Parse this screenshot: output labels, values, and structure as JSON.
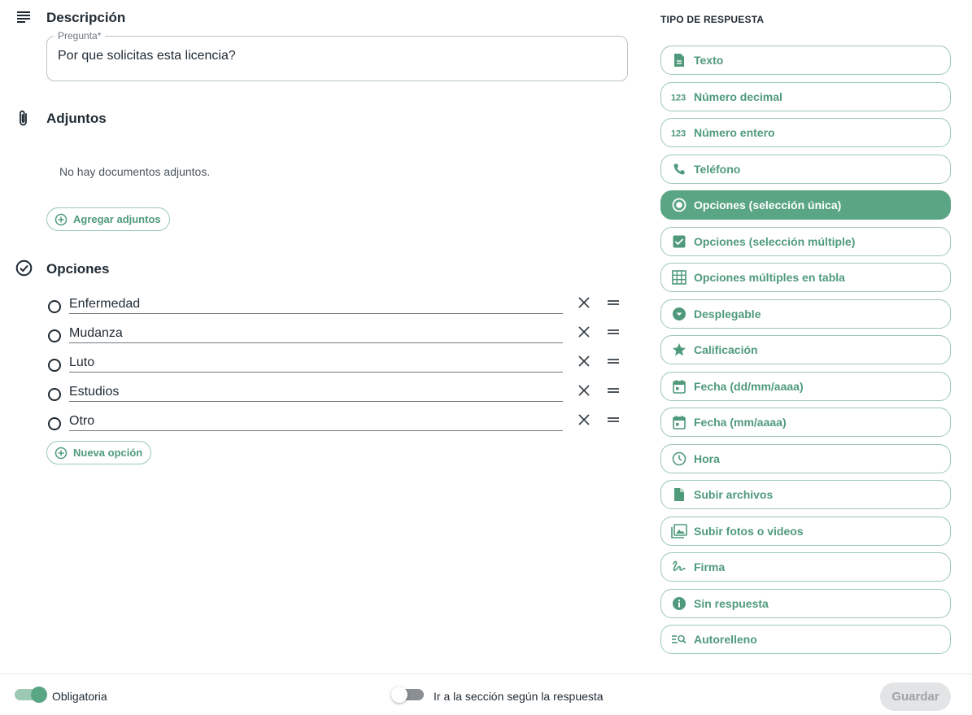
{
  "description": {
    "title": "Descripción",
    "field_label": "Pregunta",
    "required_mark": "*",
    "field_value": "Por que solicitas esta licencia?"
  },
  "attachments": {
    "title": "Adjuntos",
    "empty_message": "No hay documentos adjuntos.",
    "add_label": "Agregar adjuntos"
  },
  "options": {
    "title": "Opciones",
    "items": [
      "Enfermedad",
      "Mudanza",
      "Luto",
      "Estudios",
      "Otro"
    ],
    "add_label": "Nueva opción"
  },
  "response_types": {
    "header": "TIPO DE RESPUESTA",
    "selected": "Opciones (selección única)",
    "items": [
      {
        "label": "Texto",
        "icon": "text-document-icon"
      },
      {
        "label": "Número decimal",
        "icon": "numbers-icon"
      },
      {
        "label": "Número entero",
        "icon": "numbers-icon"
      },
      {
        "label": "Teléfono",
        "icon": "phone-icon"
      },
      {
        "label": "Opciones (selección única)",
        "icon": "radio-button-icon"
      },
      {
        "label": "Opciones (selección múltiple)",
        "icon": "checkbox-icon"
      },
      {
        "label": "Opciones múltiples en tabla",
        "icon": "grid-table-icon"
      },
      {
        "label": "Desplegable",
        "icon": "dropdown-circle-icon"
      },
      {
        "label": "Calificación",
        "icon": "star-icon"
      },
      {
        "label": "Fecha (dd/mm/aaaa)",
        "icon": "calendar-icon"
      },
      {
        "label": "Fecha (mm/aaaa)",
        "icon": "calendar-icon"
      },
      {
        "label": "Hora",
        "icon": "clock-icon"
      },
      {
        "label": "Subir archivos",
        "icon": "file-icon"
      },
      {
        "label": "Subir fotos o videos",
        "icon": "photo-library-icon"
      },
      {
        "label": "Firma",
        "icon": "signature-icon"
      },
      {
        "label": "Sin respuesta",
        "icon": "info-icon"
      },
      {
        "label": "Autorelleno",
        "icon": "autofill-search-icon"
      }
    ]
  },
  "footer": {
    "required_label": "Obligatoria",
    "required_on": true,
    "goto_label": "Ir a la sección según la respuesta",
    "goto_on": false,
    "save_label": "Guardar"
  },
  "colors": {
    "accent": "#5aa584",
    "accent_light": "#9cc8b4",
    "text": "#1f2a33",
    "disabled_bg": "#e2e4e6"
  }
}
